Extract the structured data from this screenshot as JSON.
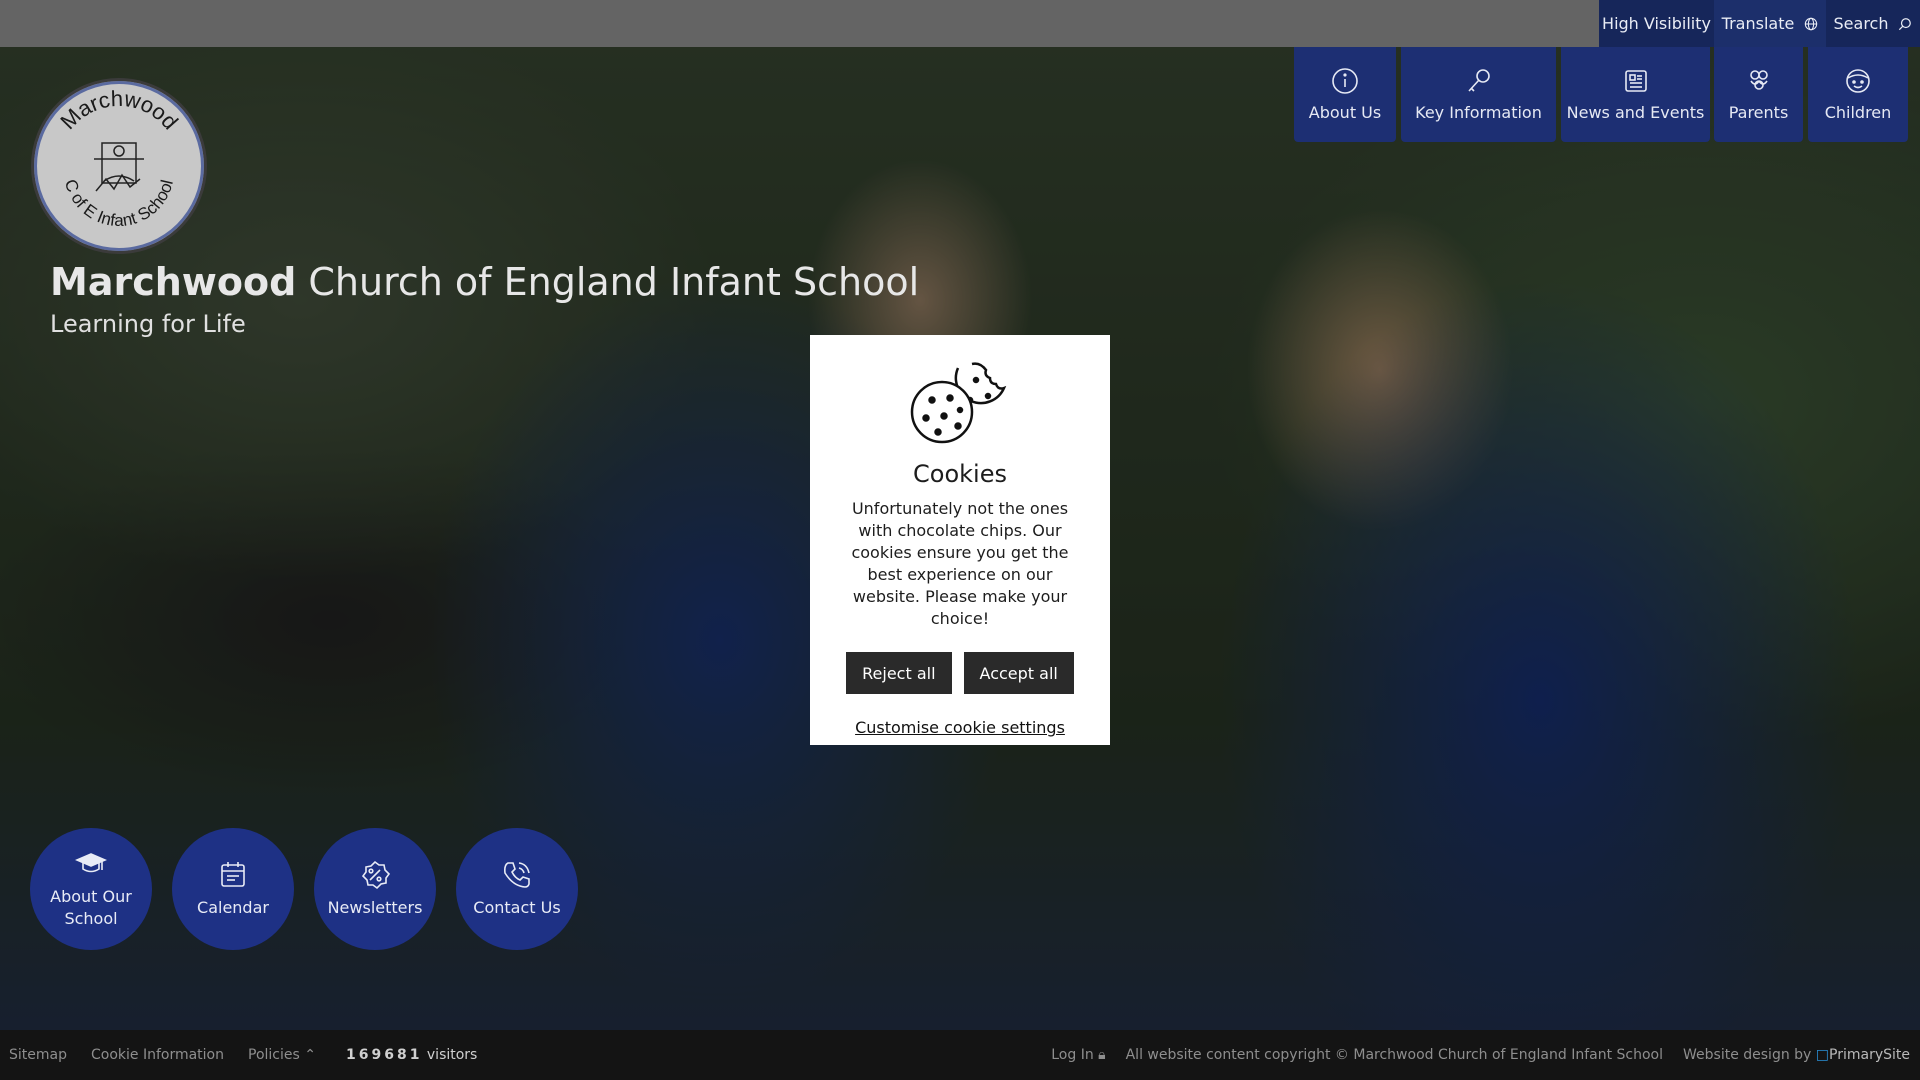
{
  "utility_bar": {
    "high_visibility": "High Visibility",
    "translate": "Translate",
    "search": "Search"
  },
  "nav": {
    "items": [
      {
        "label": "About Us",
        "icon": "info-icon"
      },
      {
        "label": "Key Information",
        "icon": "key-icon"
      },
      {
        "label": "News and Events",
        "icon": "newspaper-icon"
      },
      {
        "label": "Parents",
        "icon": "family-icon"
      },
      {
        "label": "Children",
        "icon": "child-face-icon"
      }
    ]
  },
  "school": {
    "name_bold": "Marchwood",
    "name_rest": " Church of England Infant School",
    "motto": "Learning for Life",
    "logo_text_top": "Marchwood",
    "logo_text_bottom": "C of E Infant School"
  },
  "quick_links": [
    {
      "label": "About Our School",
      "icon": "graduation-cap-icon"
    },
    {
      "label": "Calendar",
      "icon": "calendar-icon"
    },
    {
      "label": "Newsletters",
      "icon": "badge-percent-icon"
    },
    {
      "label": "Contact Us",
      "icon": "phone-icon"
    }
  ],
  "cookie_modal": {
    "title": "Cookies",
    "text": "Unfortunately not the ones with chocolate chips. Our cookies ensure you get the best experience on our website. Please make your choice!",
    "reject_label": "Reject all",
    "accept_label": "Accept all",
    "customise_label": "Customise cookie settings"
  },
  "footer": {
    "sitemap": "Sitemap",
    "cookie_info": "Cookie Information",
    "policies": "Policies",
    "counter": "169681",
    "visitors": "visitors",
    "login": "Log In",
    "copyright": "All website content copyright © Marchwood Church of England Infant School",
    "design_by": "Website design by",
    "design_company": "PrimarySite"
  },
  "colors": {
    "nav_blue": "#1d2f73",
    "quick_blue": "#1e3185",
    "util_dark": "#16265a",
    "footer_bg": "#141414",
    "topbar_bg": "#646464"
  }
}
